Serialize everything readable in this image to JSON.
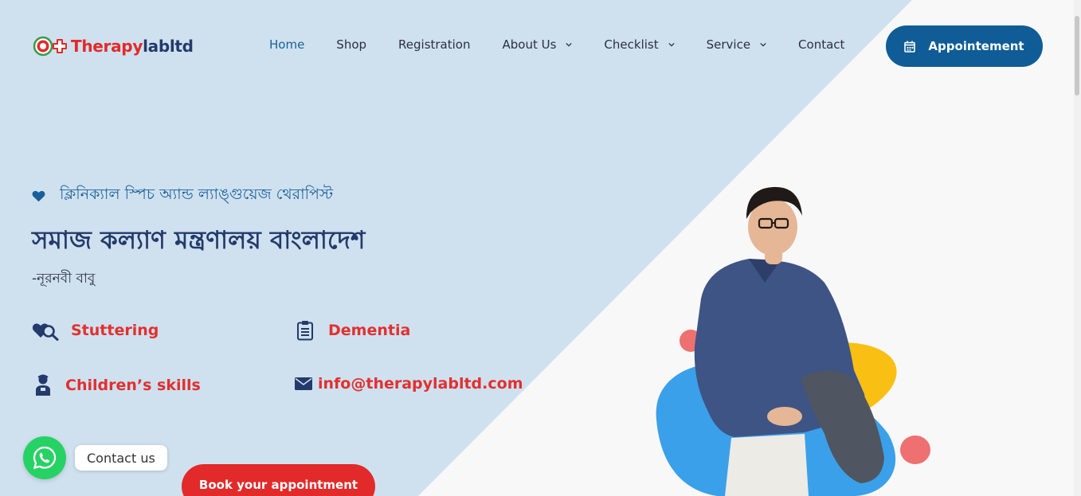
{
  "header": {
    "logo": {
      "part1": "Therapy",
      "part2": "labltd"
    },
    "nav": [
      {
        "label": "Home",
        "active": true,
        "dropdown": false
      },
      {
        "label": "Shop",
        "active": false,
        "dropdown": false
      },
      {
        "label": "Registration",
        "active": false,
        "dropdown": false
      },
      {
        "label": "About Us",
        "active": false,
        "dropdown": true
      },
      {
        "label": "Checklist",
        "active": false,
        "dropdown": true
      },
      {
        "label": "Service",
        "active": false,
        "dropdown": true
      },
      {
        "label": "Contact",
        "active": false,
        "dropdown": false
      }
    ],
    "appointment_label": "Appointement"
  },
  "hero": {
    "tagline": "ক্লিনিক্যাল স্পিচ অ্যান্ড ল্যাঙ্গুয়েজ থেরাপিস্ট",
    "title": "সমাজ কল্যাণ মন্ত্রণালয় বাংলাদেশ",
    "author": "-নূরনবী বাবু",
    "features": [
      {
        "label": "Stuttering",
        "icon": "heart-search-icon"
      },
      {
        "label": "Dementia",
        "icon": "clipboard-icon"
      },
      {
        "label": "Children’s skills",
        "icon": "child-icon"
      },
      {
        "label": "info@therapylabltd.com",
        "icon": "mail-icon"
      }
    ],
    "book_label": "Book your appointment"
  },
  "whatsapp": {
    "label": "Contact us"
  },
  "colors": {
    "primary": "#0f5c97",
    "accent": "#e22a2a",
    "heading": "#233a6b",
    "hero_bg": "#cfe2f0",
    "whatsapp": "#27d265"
  }
}
